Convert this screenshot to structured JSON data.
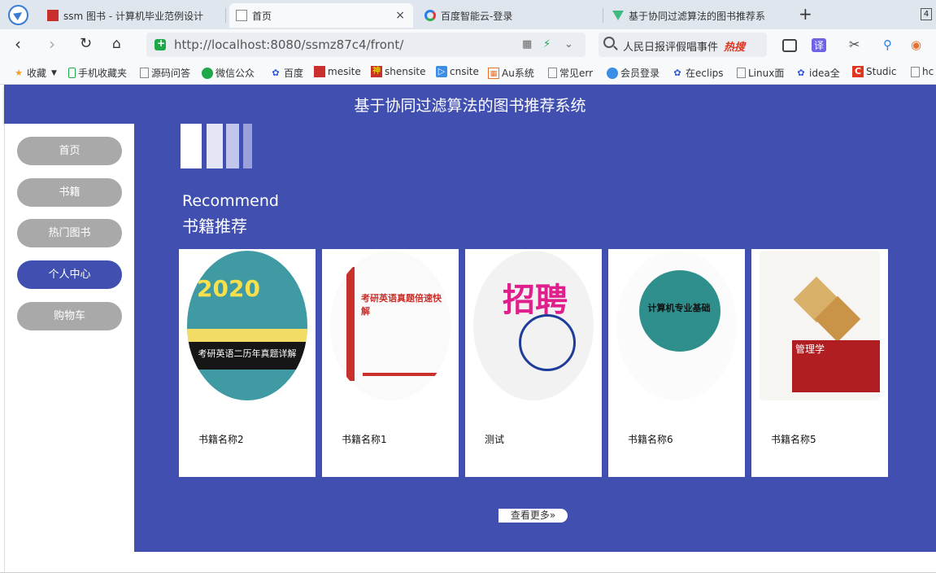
{
  "browser": {
    "tabs": [
      {
        "title": "ssm 图书 - 计算机毕业范例设计"
      },
      {
        "title": "首页",
        "close": "×"
      },
      {
        "title": "百度智能云-登录"
      },
      {
        "title": "基于协同过滤算法的图书推荐系"
      }
    ],
    "new_tab": "+",
    "tab_count": "4",
    "url": "http://localhost:8080/ssmz87c4/front/",
    "search_query": "人民日报评假唱事件",
    "search_hot": "热搜",
    "translate_label": "译"
  },
  "bookmarks": [
    {
      "label": "收藏",
      "icon": "star-icon"
    },
    {
      "label": "手机收藏夹",
      "icon": "phone-icon"
    },
    {
      "label": "源码问答",
      "icon": "page-icon"
    },
    {
      "label": "微信公众",
      "icon": "wechat-icon"
    },
    {
      "label": "百度",
      "icon": "baidu-icon"
    },
    {
      "label": "mesite",
      "icon": "mesite-icon"
    },
    {
      "label": "shensite",
      "icon": "shensite-icon"
    },
    {
      "label": "cnsite",
      "icon": "cnsite-icon"
    },
    {
      "label": "Au系统",
      "icon": "au-icon"
    },
    {
      "label": "常见err",
      "icon": "page-icon"
    },
    {
      "label": "会员登录",
      "icon": "cloud-icon"
    },
    {
      "label": "在eclips",
      "icon": "baidu-icon"
    },
    {
      "label": "Linux面",
      "icon": "page-icon"
    },
    {
      "label": "idea全",
      "icon": "baidu-icon"
    },
    {
      "label": "Studic",
      "icon": "c-icon"
    },
    {
      "label": "hc",
      "icon": "page-icon"
    }
  ],
  "site": {
    "title": "基于协同过滤算法的图书推荐系统",
    "nav": [
      {
        "label": "首页"
      },
      {
        "label": "书籍"
      },
      {
        "label": "热门图书"
      },
      {
        "label": "个人中心",
        "active": true
      },
      {
        "label": "购物车"
      }
    ],
    "section_en": "Recommend",
    "section_cn": "书籍推荐",
    "books": [
      {
        "name": "书籍名称2",
        "cover": "考研英语二历年真题详解"
      },
      {
        "name": "书籍名称1",
        "cover": "考研英语真题倍速快解"
      },
      {
        "name": "测试",
        "cover": "招聘"
      },
      {
        "name": "书籍名称6",
        "cover": "计算机专业基础"
      },
      {
        "name": "书籍名称5",
        "cover": "管理学"
      }
    ],
    "more_label": "查看更多»",
    "colors": {
      "primary": "#4150b0",
      "nav_idle": "#a9a9a9"
    }
  }
}
